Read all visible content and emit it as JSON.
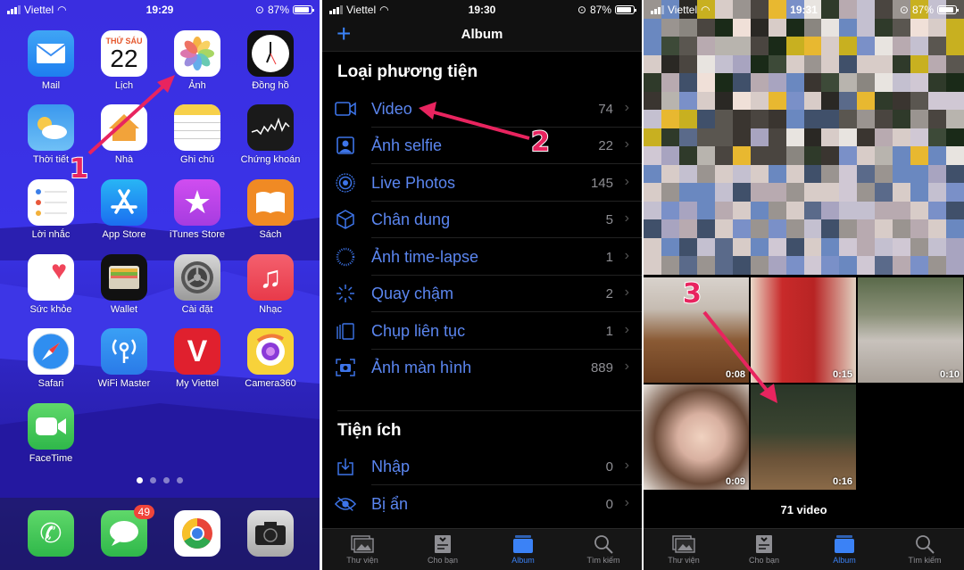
{
  "status_bars": [
    {
      "carrier": "Viettel",
      "time": "19:29",
      "battery": "87%"
    },
    {
      "carrier": "Viettel",
      "time": "19:30",
      "battery": "87%"
    },
    {
      "carrier": "Viettel",
      "time": "19:31",
      "battery": "87%"
    }
  ],
  "home": {
    "apps": [
      {
        "label": "Mail",
        "icon": "mail-icon"
      },
      {
        "label": "Lịch",
        "icon": "calendar-icon",
        "weekday": "THỨ SÁU",
        "day": "22"
      },
      {
        "label": "Ảnh",
        "icon": "photos-icon"
      },
      {
        "label": "Đồng hồ",
        "icon": "clock-icon"
      },
      {
        "label": "Thời tiết",
        "icon": "weather-icon"
      },
      {
        "label": "Nhà",
        "icon": "home-icon"
      },
      {
        "label": "Ghi chú",
        "icon": "notes-icon"
      },
      {
        "label": "Chứng khoán",
        "icon": "stocks-icon"
      },
      {
        "label": "Lời nhắc",
        "icon": "reminders-icon"
      },
      {
        "label": "App Store",
        "icon": "app-store-icon"
      },
      {
        "label": "iTunes Store",
        "icon": "itunes-store-icon"
      },
      {
        "label": "Sách",
        "icon": "books-icon"
      },
      {
        "label": "Sức khỏe",
        "icon": "health-icon"
      },
      {
        "label": "Wallet",
        "icon": "wallet-icon"
      },
      {
        "label": "Cài đặt",
        "icon": "settings-icon"
      },
      {
        "label": "Nhạc",
        "icon": "music-icon"
      },
      {
        "label": "Safari",
        "icon": "safari-icon"
      },
      {
        "label": "WiFi Master",
        "icon": "wifi-master-icon"
      },
      {
        "label": "My Viettel",
        "icon": "my-viettel-icon"
      },
      {
        "label": "Camera360",
        "icon": "camera360-icon"
      },
      {
        "label": "FaceTime",
        "icon": "facetime-icon"
      }
    ],
    "page_count": 4,
    "current_page": 1,
    "dock": [
      {
        "name": "Phone",
        "icon": "phone-icon"
      },
      {
        "name": "Messages",
        "icon": "messages-icon",
        "badge": "49"
      },
      {
        "name": "Chrome",
        "icon": "chrome-icon"
      },
      {
        "name": "Camera",
        "icon": "camera-icon"
      }
    ],
    "step": "1"
  },
  "album": {
    "title": "Album",
    "add_label": "+",
    "media_types_title": "Loại phương tiện",
    "media_types": [
      {
        "label": "Video",
        "count": "74",
        "icon": "video-icon"
      },
      {
        "label": "Ảnh selfie",
        "count": "22",
        "icon": "selfie-icon"
      },
      {
        "label": "Live Photos",
        "count": "145",
        "icon": "live-photos-icon"
      },
      {
        "label": "Chân dung",
        "count": "5",
        "icon": "portrait-cube-icon"
      },
      {
        "label": "Ảnh time-lapse",
        "count": "1",
        "icon": "timelapse-icon"
      },
      {
        "label": "Quay chậm",
        "count": "2",
        "icon": "slow-motion-icon"
      },
      {
        "label": "Chụp liên tục",
        "count": "1",
        "icon": "burst-icon"
      },
      {
        "label": "Ảnh màn hình",
        "count": "889",
        "icon": "screenshot-icon"
      }
    ],
    "utilities_title": "Tiện ích",
    "utilities": [
      {
        "label": "Nhập",
        "count": "0",
        "icon": "import-icon"
      },
      {
        "label": "Bị ẩn",
        "count": "0",
        "icon": "hidden-eye-icon"
      }
    ],
    "step": "2"
  },
  "video_album": {
    "thumbnails": [
      {
        "duration": "0:08"
      },
      {
        "duration": "0:15"
      },
      {
        "duration": "0:10"
      },
      {
        "duration": "0:09"
      },
      {
        "duration": "0:16"
      }
    ],
    "count_label": "71 video",
    "step": "3"
  },
  "tabbar": {
    "tabs": [
      {
        "label": "Thư viện",
        "icon": "library-icon"
      },
      {
        "label": "Cho bạn",
        "icon": "for-you-icon"
      },
      {
        "label": "Album",
        "icon": "album-icon",
        "active": true
      },
      {
        "label": "Tìm kiếm",
        "icon": "search-icon"
      }
    ]
  },
  "colors": {
    "accent": "#3b82f6",
    "annotation": "#e8245f",
    "home_wallpaper": "#3a2ee0"
  }
}
